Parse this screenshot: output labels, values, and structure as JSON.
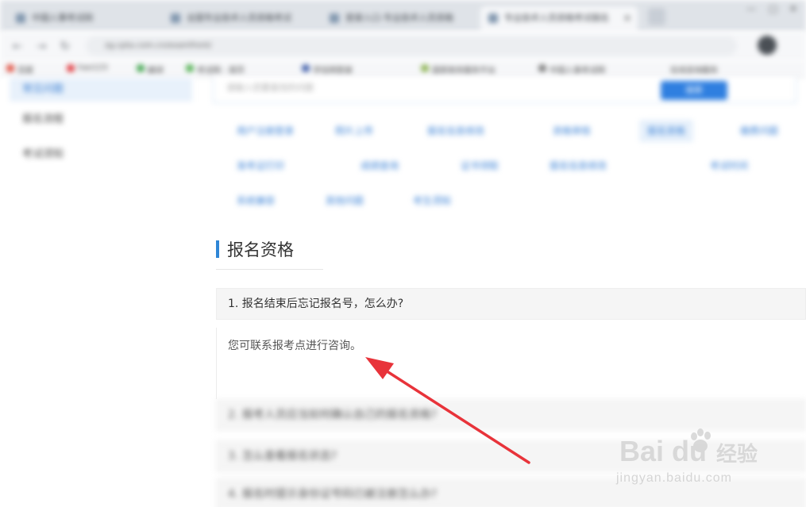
{
  "browser": {
    "tabs": [
      {
        "label": "中国人事考试网"
      },
      {
        "label": "全国专业技术人员资格考试"
      },
      {
        "label": "登录入口-专业技术人员资格"
      },
      {
        "label": "专业技术人员资格考试报名"
      }
    ],
    "address": "zg.cpta.com.cn/examfront/",
    "bookmarks": [
      "百度",
      "hao123",
      "翻译",
      "考试网 - 首页",
      "学信网登录",
      "国家政务服务平台",
      "中国人事考试网",
      "在线咨询服务"
    ]
  },
  "sidebar": {
    "items": [
      {
        "label": "常见问题"
      },
      {
        "label": "报名流程"
      },
      {
        "label": "考试须知"
      }
    ]
  },
  "search": {
    "placeholder": "请输入您要查找的问题",
    "button": "搜索"
  },
  "categories": {
    "row1": [
      "用户注册登录",
      "照片上传",
      "报名信息修改",
      "资格审核",
      "报名资格",
      "缴费问题"
    ],
    "row2": [
      "准考证打印",
      "成绩查询",
      "证书领取",
      "报名信息修改",
      "考试时间"
    ],
    "row3": [
      "系统兼容",
      "其他问题",
      "考生须知"
    ]
  },
  "section": {
    "title": "报名资格"
  },
  "faq": [
    {
      "question": "1. 报名结束后忘记报名号，怎么办?",
      "answer": "您可联系报考点进行咨询。"
    },
    {
      "question": "2. 报考人员应当如何确认自己的报名资格?"
    },
    {
      "question": "3. 怎么查看报名状态?"
    },
    {
      "question": "4. 报名时提示身份证号码已被注册怎么办?"
    }
  ],
  "watermark": {
    "logo": "Bai du",
    "name": "经验",
    "url": "jingyan.baidu.com"
  },
  "colors": {
    "accent": "#2f86d6",
    "arrow": "#e8333a"
  }
}
